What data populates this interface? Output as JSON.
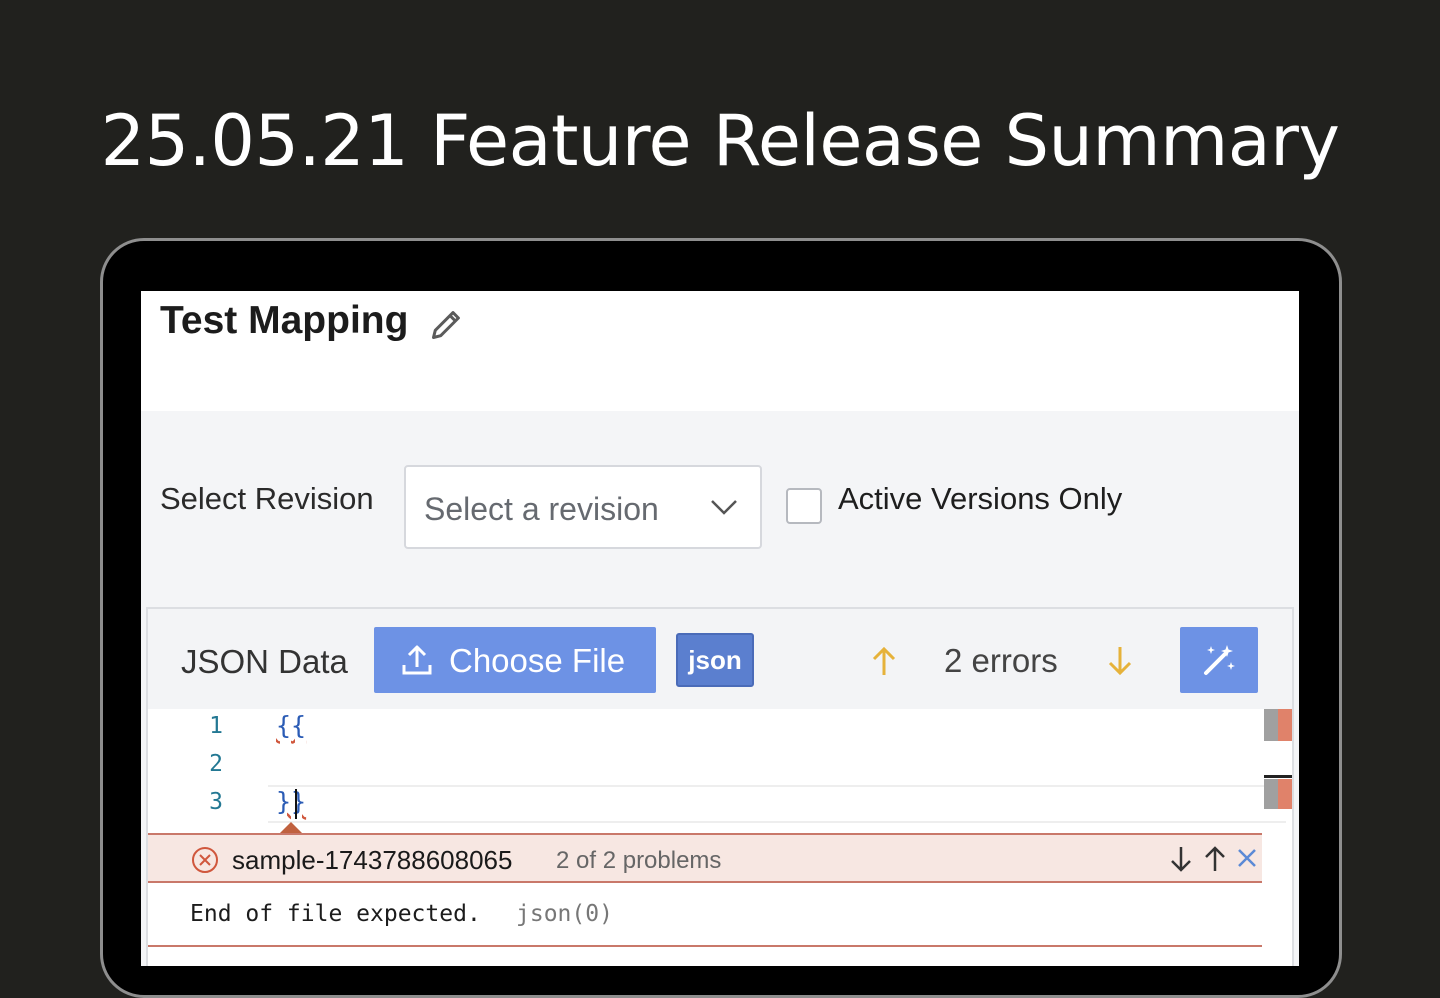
{
  "headline": "25.05.21 Feature Release Summary",
  "page": {
    "title": "Test Mapping"
  },
  "revision": {
    "label": "Select Revision",
    "placeholder": "Select a revision",
    "active_label": "Active Versions Only",
    "active_checked": false
  },
  "json_panel": {
    "label": "JSON Data",
    "choose_file": "Choose File",
    "badge": "json",
    "errors": "2 errors"
  },
  "editor": {
    "lines": [
      {
        "num": "1",
        "code": "{{"
      },
      {
        "num": "2",
        "code": ""
      },
      {
        "num": "3",
        "code": "}}"
      }
    ]
  },
  "problems": {
    "file": "sample-1743788608065",
    "count": "2 of 2 problems",
    "message": "End of file expected.",
    "source": "json(0)"
  },
  "colors": {
    "accent": "#6d92e5",
    "error": "#c9786a",
    "warning_arrow": "#e6b23a"
  }
}
